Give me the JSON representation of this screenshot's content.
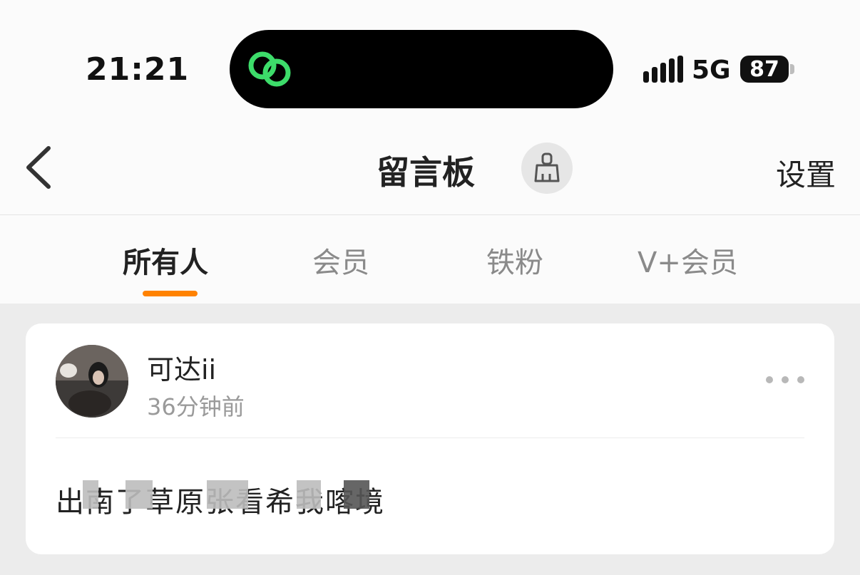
{
  "status_bar": {
    "time": "21:21",
    "island_icon": "link-rings-icon",
    "network": "5G",
    "battery": "87"
  },
  "nav": {
    "back_icon": "chevron-left-icon",
    "title": "留言板",
    "brush_icon": "brush-icon",
    "settings": "设置"
  },
  "tabs": [
    {
      "label": "所有人",
      "active": true
    },
    {
      "label": "会员",
      "active": false
    },
    {
      "label": "铁粉",
      "active": false
    },
    {
      "label": "V+会员",
      "active": false
    }
  ],
  "accent_color": "#ff8200",
  "post": {
    "username": "可达ii",
    "time": "36分钟前",
    "more_icon": "more-horizontal-icon",
    "message": "出南了草原张看希我喀境"
  }
}
